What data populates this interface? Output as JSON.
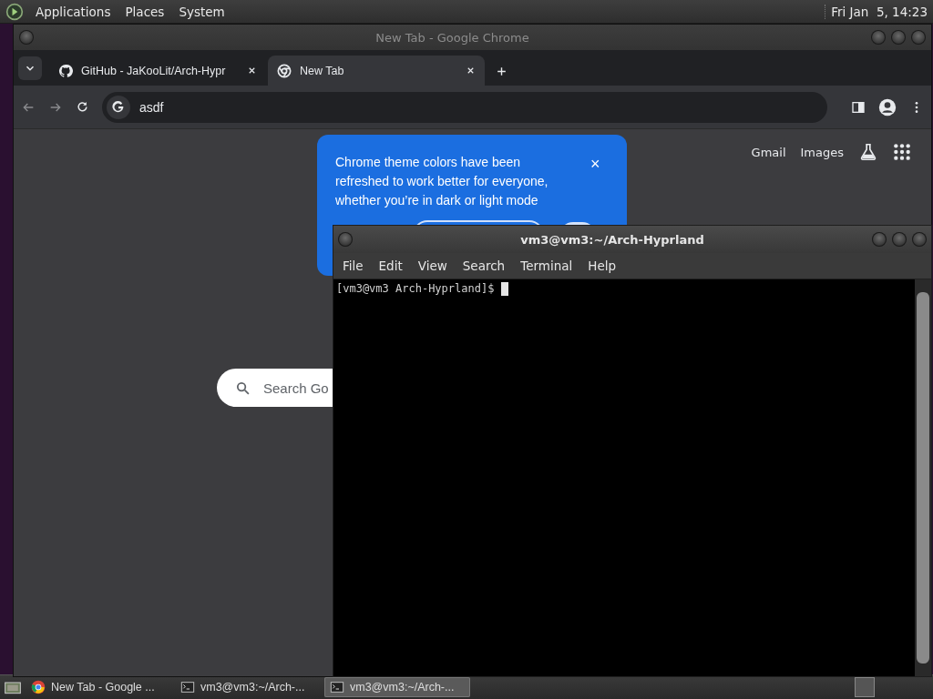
{
  "top_panel": {
    "menus": [
      "Applications",
      "Places",
      "System"
    ],
    "clock": "Fri Jan  5, 14:23"
  },
  "browser": {
    "title": "New Tab - Google Chrome",
    "tabs": [
      {
        "label": "GitHub - JaKooLit/Arch-Hypr",
        "kind": "github",
        "selected": false
      },
      {
        "label": "New Tab",
        "kind": "chrome",
        "selected": true
      }
    ],
    "address": "asdf",
    "popup": {
      "text": "Chrome theme colors have been refreshed to work better for everyone, whether you’re in dark or light mode",
      "close": "×"
    },
    "links": [
      "Gmail",
      "Images"
    ],
    "search": {
      "placeholder": "Search Go"
    }
  },
  "terminal": {
    "title": "vm3@vm3:~/Arch-Hyprland",
    "menus": [
      "File",
      "Edit",
      "View",
      "Search",
      "Terminal",
      "Help"
    ],
    "prompt": "[vm3@vm3 Arch-Hyprland]$ "
  },
  "taskbar": {
    "tasks": [
      {
        "label": "New Tab - Google ...",
        "kind": "chrome",
        "selected": false
      },
      {
        "label": "vm3@vm3:~/Arch-...",
        "kind": "terminal",
        "selected": false
      },
      {
        "label": "vm3@vm3:~/Arch-...",
        "kind": "terminal",
        "selected": true
      }
    ]
  }
}
